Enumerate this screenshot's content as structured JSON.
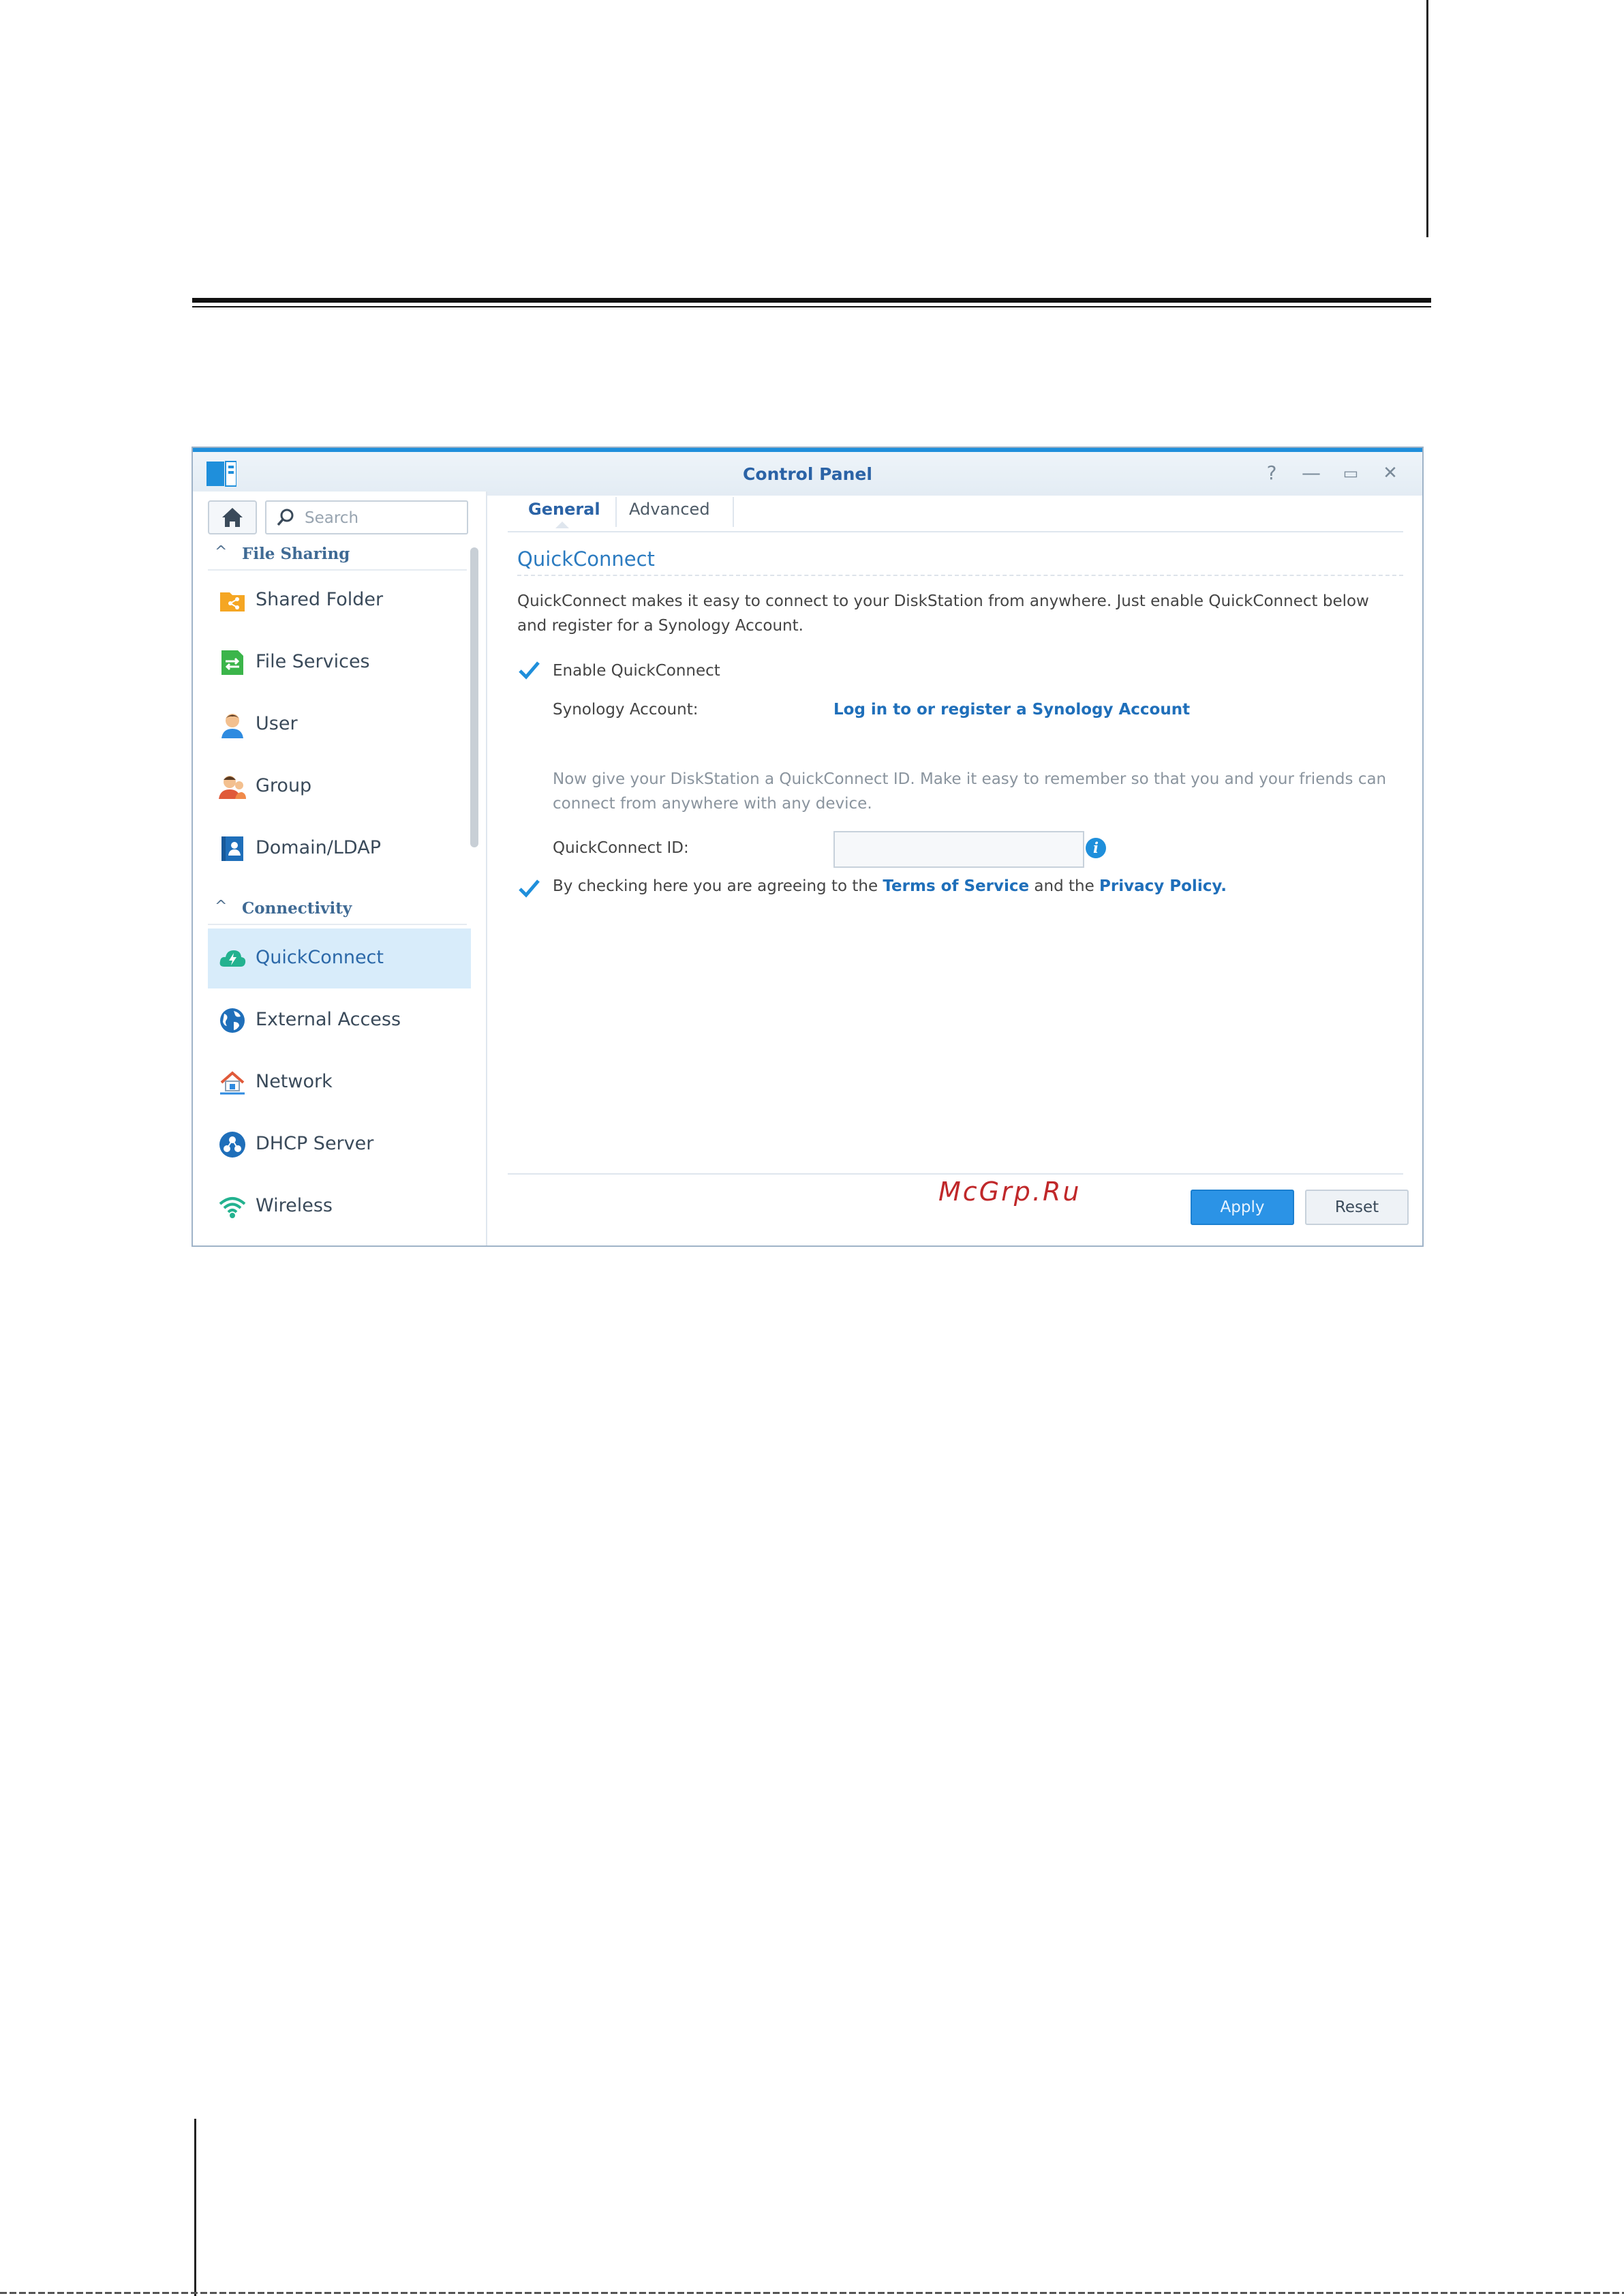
{
  "window": {
    "title": "Control Panel",
    "controls": {
      "help": "?",
      "minimize": "—",
      "maximize": "▭",
      "close": "✕"
    }
  },
  "sidebar": {
    "search_placeholder": "Search",
    "groups": [
      {
        "label": "File Sharing"
      },
      {
        "label": "Connectivity"
      }
    ],
    "items": [
      {
        "label": "Shared Folder",
        "icon": "shared-folder-icon"
      },
      {
        "label": "File Services",
        "icon": "file-services-icon"
      },
      {
        "label": "User",
        "icon": "user-icon"
      },
      {
        "label": "Group",
        "icon": "group-icon"
      },
      {
        "label": "Domain/LDAP",
        "icon": "domain-ldap-icon"
      },
      {
        "label": "QuickConnect",
        "icon": "quickconnect-icon",
        "selected": true
      },
      {
        "label": "External Access",
        "icon": "globe-icon"
      },
      {
        "label": "Network",
        "icon": "network-house-icon"
      },
      {
        "label": "DHCP Server",
        "icon": "dhcp-icon"
      },
      {
        "label": "Wireless",
        "icon": "wifi-icon"
      }
    ]
  },
  "tabs": [
    {
      "label": "General",
      "active": true
    },
    {
      "label": "Advanced",
      "active": false
    }
  ],
  "main": {
    "section_title": "QuickConnect",
    "description": "QuickConnect makes it easy to connect to your DiskStation from anywhere. Just enable QuickConnect below and register for a Synology Account.",
    "enable_label": "Enable QuickConnect",
    "enable_checked": true,
    "account_label": "Synology Account:",
    "account_link": "Log in to or register a Synology Account",
    "id_hint": "Now give your DiskStation a QuickConnect ID. Make it easy to remember so that you and your friends can connect from anywhere with any device.",
    "id_label": "QuickConnect ID:",
    "id_value": "",
    "terms_checked": true,
    "terms_prefix": "By checking here you are agreeing to the",
    "terms_link": "Terms of Service",
    "terms_mid": "and the",
    "privacy_link": "Privacy Policy",
    "terms_suffix": "."
  },
  "watermark": "McGrp.Ru",
  "buttons": {
    "apply": "Apply",
    "reset": "Reset"
  },
  "colors": {
    "accent": "#1f8fdb",
    "selected_bg": "#d8ecfa",
    "link": "#1f6fba"
  }
}
